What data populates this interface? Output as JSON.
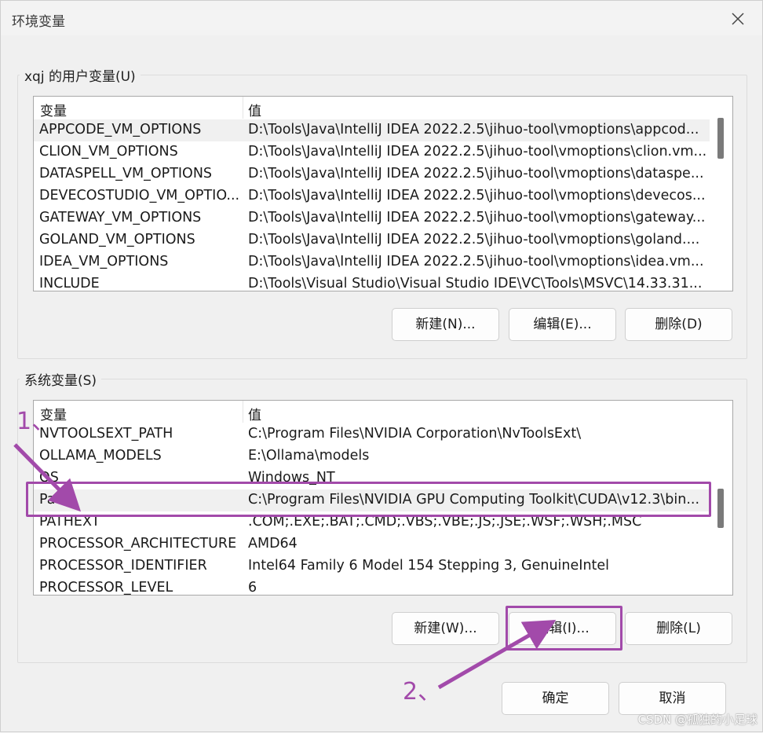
{
  "window": {
    "title": "环境变量"
  },
  "user_vars": {
    "group_label": "xqj 的用户变量(U)",
    "col_variable": "变量",
    "col_value": "值",
    "rows": [
      {
        "name": "APPCODE_VM_OPTIONS",
        "value": "D:\\Tools\\Java\\IntelliJ IDEA 2022.2.5\\jihuo-tool\\vmoptions\\appcod..."
      },
      {
        "name": "CLION_VM_OPTIONS",
        "value": "D:\\Tools\\Java\\IntelliJ IDEA 2022.2.5\\jihuo-tool\\vmoptions\\clion.vm..."
      },
      {
        "name": "DATASPELL_VM_OPTIONS",
        "value": "D:\\Tools\\Java\\IntelliJ IDEA 2022.2.5\\jihuo-tool\\vmoptions\\dataspe..."
      },
      {
        "name": "DEVECOSTUDIO_VM_OPTIO...",
        "value": "D:\\Tools\\Java\\IntelliJ IDEA 2022.2.5\\jihuo-tool\\vmoptions\\devecos..."
      },
      {
        "name": "GATEWAY_VM_OPTIONS",
        "value": "D:\\Tools\\Java\\IntelliJ IDEA 2022.2.5\\jihuo-tool\\vmoptions\\gateway..."
      },
      {
        "name": "GOLAND_VM_OPTIONS",
        "value": "D:\\Tools\\Java\\IntelliJ IDEA 2022.2.5\\jihuo-tool\\vmoptions\\goland...."
      },
      {
        "name": "IDEA_VM_OPTIONS",
        "value": "D:\\Tools\\Java\\IntelliJ IDEA 2022.2.5\\jihuo-tool\\vmoptions\\idea.vm..."
      },
      {
        "name": "INCLUDE",
        "value": "D:\\Tools\\Visual Studio\\Visual Studio IDE\\VC\\Tools\\MSVC\\14.33.31..."
      }
    ],
    "new_label": "新建(N)...",
    "edit_label": "编辑(E)...",
    "delete_label": "删除(D)"
  },
  "system_vars": {
    "group_label": "系统变量(S)",
    "col_variable": "变量",
    "col_value": "值",
    "rows": [
      {
        "name": "NVTOOLSEXT_PATH",
        "value": "C:\\Program Files\\NVIDIA Corporation\\NvToolsExt\\"
      },
      {
        "name": "OLLAMA_MODELS",
        "value": "E:\\Ollama\\models"
      },
      {
        "name": "OS",
        "value": "Windows_NT"
      },
      {
        "name": "Path",
        "value": "C:\\Program Files\\NVIDIA GPU Computing Toolkit\\CUDA\\v12.3\\bin..."
      },
      {
        "name": "PATHEXT",
        "value": ".COM;.EXE;.BAT;.CMD;.VBS;.VBE;.JS;.JSE;.WSF;.WSH;.MSC"
      },
      {
        "name": "PROCESSOR_ARCHITECTURE",
        "value": "AMD64"
      },
      {
        "name": "PROCESSOR_IDENTIFIER",
        "value": "Intel64 Family 6 Model 154 Stepping 3, GenuineIntel"
      },
      {
        "name": "PROCESSOR_LEVEL",
        "value": "6"
      }
    ],
    "new_label": "新建(W)...",
    "edit_label": "编辑(I)...",
    "delete_label": "删除(L)"
  },
  "footer": {
    "ok_label": "确定",
    "cancel_label": "取消"
  },
  "annotations": {
    "step1": "1、",
    "step2": "2、",
    "color": "#a24aaa"
  },
  "watermark": "CSDN @孤独的小足球",
  "icons": {
    "close": "close-icon"
  }
}
